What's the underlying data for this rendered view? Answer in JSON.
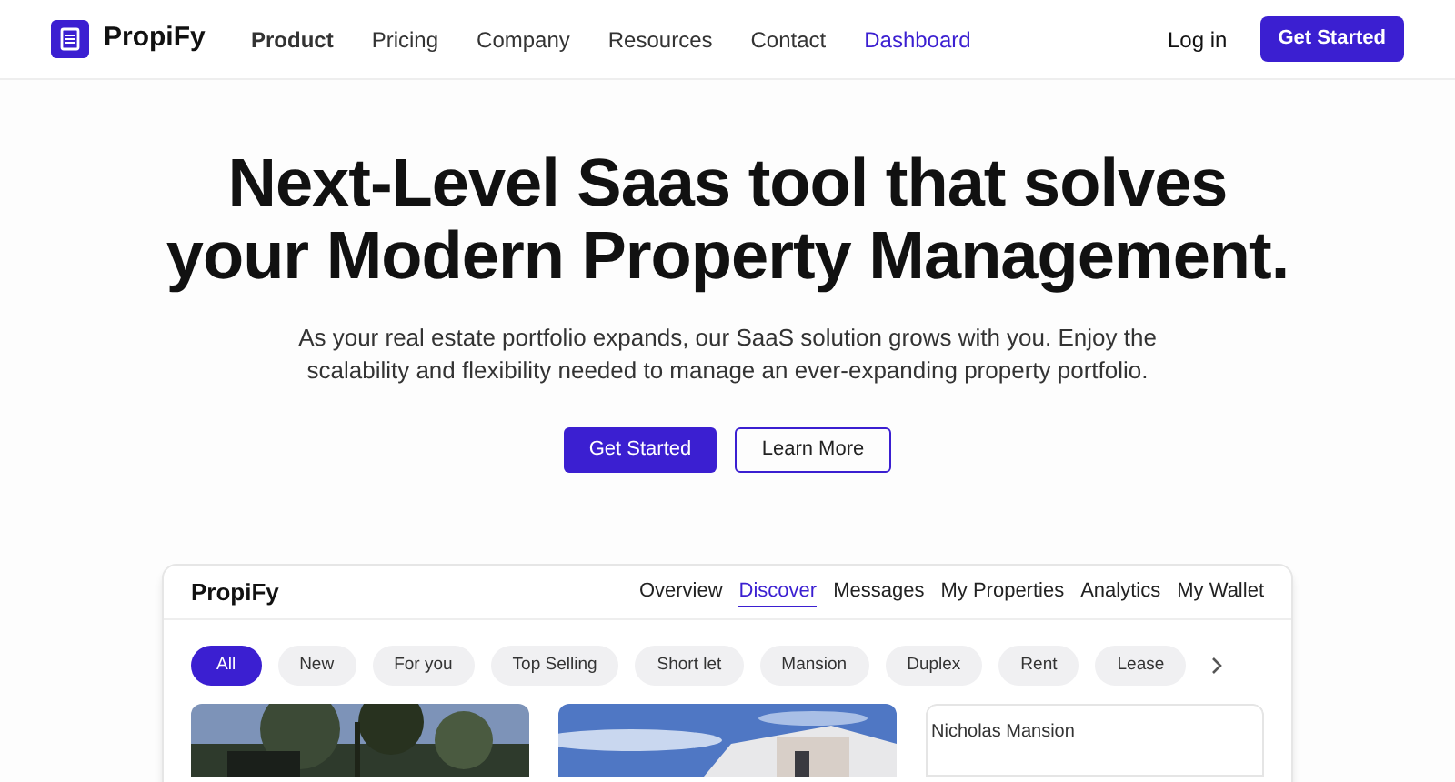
{
  "header": {
    "brand": "PropiFy",
    "nav": [
      {
        "label": "Product",
        "selected": true,
        "kind": "plain"
      },
      {
        "label": "Pricing",
        "selected": false,
        "kind": "plain"
      },
      {
        "label": "Company",
        "selected": false,
        "kind": "plain"
      },
      {
        "label": "Resources",
        "selected": false,
        "kind": "plain"
      },
      {
        "label": "Contact",
        "selected": false,
        "kind": "plain"
      },
      {
        "label": "Dashboard",
        "selected": false,
        "kind": "accent"
      }
    ],
    "login": "Log in",
    "cta": "Get Started"
  },
  "hero": {
    "title_lines": [
      "Next-Level Saas tool that solves",
      "your Modern Property Management."
    ],
    "subtitle": "As your real estate portfolio expands, our SaaS solution grows with you. Enjoy the scalability and flexibility needed to manage an ever-expanding property portfolio.",
    "primary": "Get Started",
    "secondary": "Learn More"
  },
  "dashboard": {
    "brand": "PropiFy",
    "tabs": [
      {
        "label": "Overview",
        "selected": false
      },
      {
        "label": "Discover",
        "selected": true
      },
      {
        "label": "Messages",
        "selected": false
      },
      {
        "label": "My Properties",
        "selected": false
      },
      {
        "label": "Analytics",
        "selected": false
      },
      {
        "label": "My Wallet",
        "selected": false
      }
    ],
    "filters": [
      {
        "label": "All",
        "selected": true
      },
      {
        "label": "New",
        "selected": false
      },
      {
        "label": "For you",
        "selected": false
      },
      {
        "label": "Top Selling",
        "selected": false
      },
      {
        "label": "Short let",
        "selected": false
      },
      {
        "label": "Mansion",
        "selected": false
      },
      {
        "label": "Duplex",
        "selected": false
      },
      {
        "label": "Rent",
        "selected": false
      },
      {
        "label": "Lease",
        "selected": false
      }
    ],
    "cards": [
      {
        "kind": "picture"
      },
      {
        "kind": "picture"
      },
      {
        "kind": "broken",
        "alt": "Nicholas Mansion"
      }
    ]
  }
}
